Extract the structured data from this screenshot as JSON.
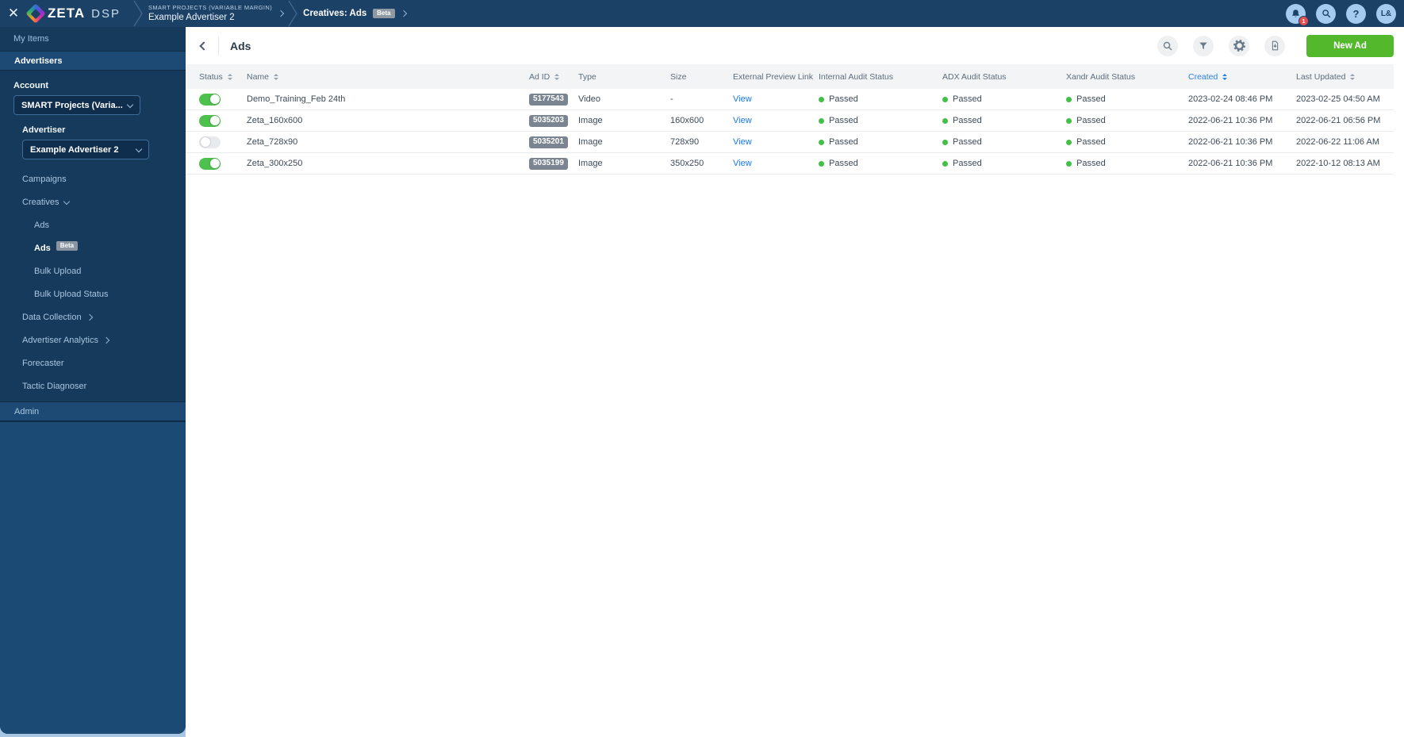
{
  "colors": {
    "brand_green": "#54b82c",
    "toggle_on_green": "#4ec04e",
    "status_passed_green": "#43bf47",
    "link_blue": "#1a78e0",
    "sorted_header_blue": "#2d7fe0",
    "topbar_navy": "#1c4166",
    "notification_red": "#e64c4c"
  },
  "topbar": {
    "logo_text": "ZETA",
    "logo_suffix": "DSP",
    "breadcrumb": {
      "account_label": "SMART PROJECTS (VARIABLE MARGIN)",
      "advertiser": "Example Advertiser 2",
      "section": "Creatives: Ads",
      "section_badge": "Beta"
    },
    "notification_count": "1",
    "help_label": "?",
    "avatar_initials": "L&"
  },
  "sidebar": {
    "my_items_label": "My Items",
    "advertisers_label": "Advertisers",
    "admin_label": "Admin",
    "account_label": "Account",
    "account_value": "SMART Projects (Varia...",
    "advertiser_label": "Advertiser",
    "advertiser_value": "Example Advertiser 2",
    "nav": [
      {
        "label": "Campaigns",
        "level": 1
      },
      {
        "label": "Creatives",
        "level": 1,
        "chevron": "down",
        "expanded": true
      },
      {
        "label": "Ads",
        "level": 2
      },
      {
        "label": "Ads",
        "level": 2,
        "badge": "Beta",
        "active": true
      },
      {
        "label": "Bulk Upload",
        "level": 2
      },
      {
        "label": "Bulk Upload Status",
        "level": 2
      },
      {
        "label": "Data Collection",
        "level": 1,
        "chevron": "right"
      },
      {
        "label": "Advertiser Analytics",
        "level": 1,
        "chevron": "right"
      },
      {
        "label": "Forecaster",
        "level": 1
      },
      {
        "label": "Tactic Diagnoser",
        "level": 1
      }
    ]
  },
  "main": {
    "title": "Ads",
    "new_ad_label": "New Ad",
    "table": {
      "columns": [
        {
          "label": "Status",
          "sortable": true
        },
        {
          "label": "Name",
          "sortable": true
        },
        {
          "label": "Ad ID",
          "sortable": true
        },
        {
          "label": "Type",
          "sortable": false
        },
        {
          "label": "Size",
          "sortable": false
        },
        {
          "label": "External Preview Link",
          "sortable": false
        },
        {
          "label": "Internal Audit Status",
          "sortable": false
        },
        {
          "label": "ADX Audit Status",
          "sortable": false
        },
        {
          "label": "Xandr Audit Status",
          "sortable": false
        },
        {
          "label": "Created",
          "sortable": true,
          "sorted": true
        },
        {
          "label": "Last Updated",
          "sortable": true
        }
      ],
      "rows": [
        {
          "enabled": true,
          "name": "Demo_Training_Feb 24th",
          "ad_id": "5177543",
          "type": "Video",
          "size": "-",
          "preview": "View",
          "internal": "Passed",
          "adx": "Passed",
          "xandr": "Passed",
          "created": "2023-02-24 08:46 PM",
          "updated": "2023-02-25 04:50 AM"
        },
        {
          "enabled": true,
          "name": "Zeta_160x600",
          "ad_id": "5035203",
          "type": "Image",
          "size": "160x600",
          "preview": "View",
          "internal": "Passed",
          "adx": "Passed",
          "xandr": "Passed",
          "created": "2022-06-21 10:36 PM",
          "updated": "2022-06-21 06:56 PM"
        },
        {
          "enabled": false,
          "name": "Zeta_728x90",
          "ad_id": "5035201",
          "type": "Image",
          "size": "728x90",
          "preview": "View",
          "internal": "Passed",
          "adx": "Passed",
          "xandr": "Passed",
          "created": "2022-06-21 10:36 PM",
          "updated": "2022-06-22 11:06 AM"
        },
        {
          "enabled": true,
          "name": "Zeta_300x250",
          "ad_id": "5035199",
          "type": "Image",
          "size": "350x250",
          "preview": "View",
          "internal": "Passed",
          "adx": "Passed",
          "xandr": "Passed",
          "created": "2022-06-21 10:36 PM",
          "updated": "2022-10-12 08:13 AM"
        }
      ]
    }
  }
}
